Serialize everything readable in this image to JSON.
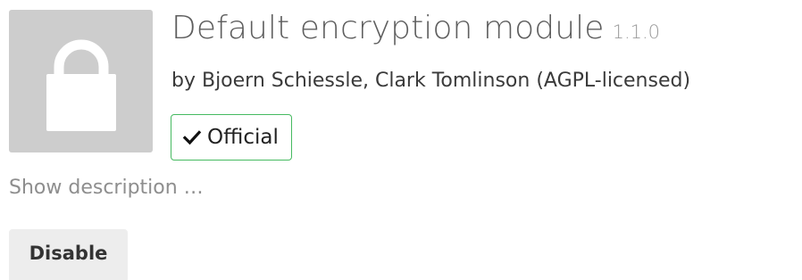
{
  "app": {
    "name": "Default encryption module",
    "version": "1.1.0",
    "author": "by Bjoern Schiessle, Clark Tomlinson (AGPL-licensed)",
    "badge_label": "Official",
    "show_description_label": "Show description …",
    "disable_label": "Disable",
    "icon": "lock-icon",
    "badge_icon": "check-icon"
  },
  "colors": {
    "icon_background": "#cdcdcd",
    "badge_border": "#46ba61",
    "button_background": "#ededed"
  }
}
